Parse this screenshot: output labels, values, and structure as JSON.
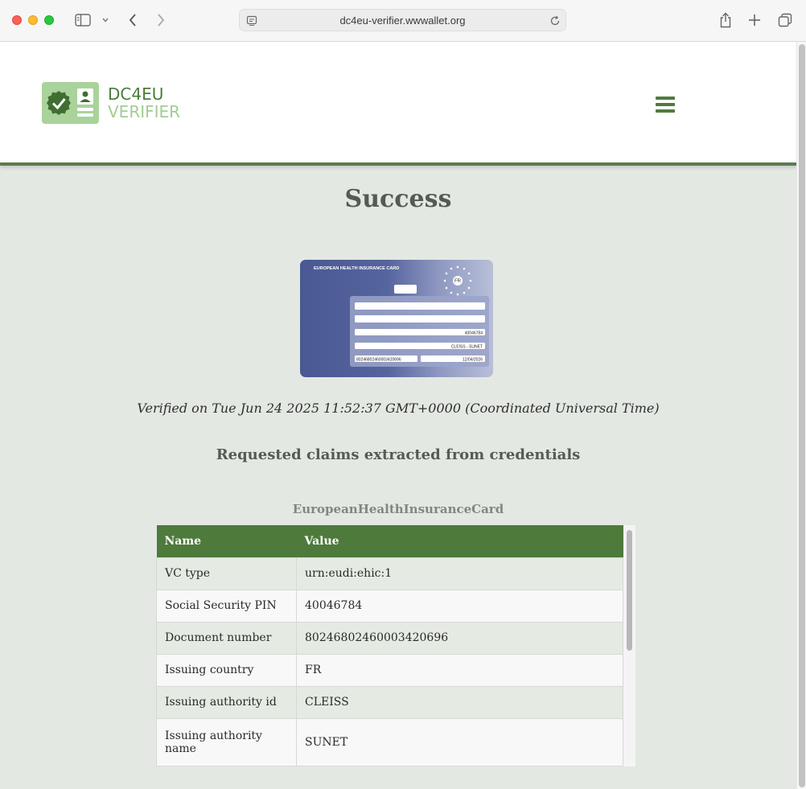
{
  "browser": {
    "url": "dc4eu-verifier.wwwallet.org"
  },
  "brand": {
    "line1": "DC4EU",
    "line2": "VERIFIER"
  },
  "page": {
    "title": "Success",
    "verified_text": "Verified on Tue Jun 24 2025 11:52:37 GMT+0000 (Coordinated Universal Time)",
    "subtitle": "Requested claims extracted from credentials",
    "credential_name": "EuropeanHealthInsuranceCard"
  },
  "card": {
    "heading": "EUROPEAN HEALTH INSURANCE CARD",
    "country": "FR",
    "field_ssn": "40046784",
    "field_institution": "CLEISS - SUNET",
    "field_doc_number": "80246802460003420696",
    "field_expiry": "12/04/2026"
  },
  "table": {
    "headers": {
      "name": "Name",
      "value": "Value"
    },
    "rows": [
      {
        "name": "VC type",
        "value": "urn:eudi:ehic:1"
      },
      {
        "name": "Social Security PIN",
        "value": "40046784"
      },
      {
        "name": "Document number",
        "value": "80246802460003420696"
      },
      {
        "name": "Issuing country",
        "value": "FR"
      },
      {
        "name": "Issuing authority id",
        "value": "CLEISS"
      },
      {
        "name": "Issuing authority name",
        "value": "SUNET"
      }
    ]
  },
  "colors": {
    "accent_green": "#4e7a3c",
    "light_green": "#a3cc93",
    "page_background": "#e3e8e2",
    "card_blue": "#4f5c98"
  },
  "icons": [
    "sidebar-icon",
    "chevron-down-icon",
    "back-icon",
    "forward-icon",
    "site-settings-icon",
    "reload-icon",
    "share-icon",
    "new-tab-icon",
    "tabs-overview-icon",
    "hamburger-menu-icon",
    "verified-badge-icon",
    "id-card-icon"
  ]
}
